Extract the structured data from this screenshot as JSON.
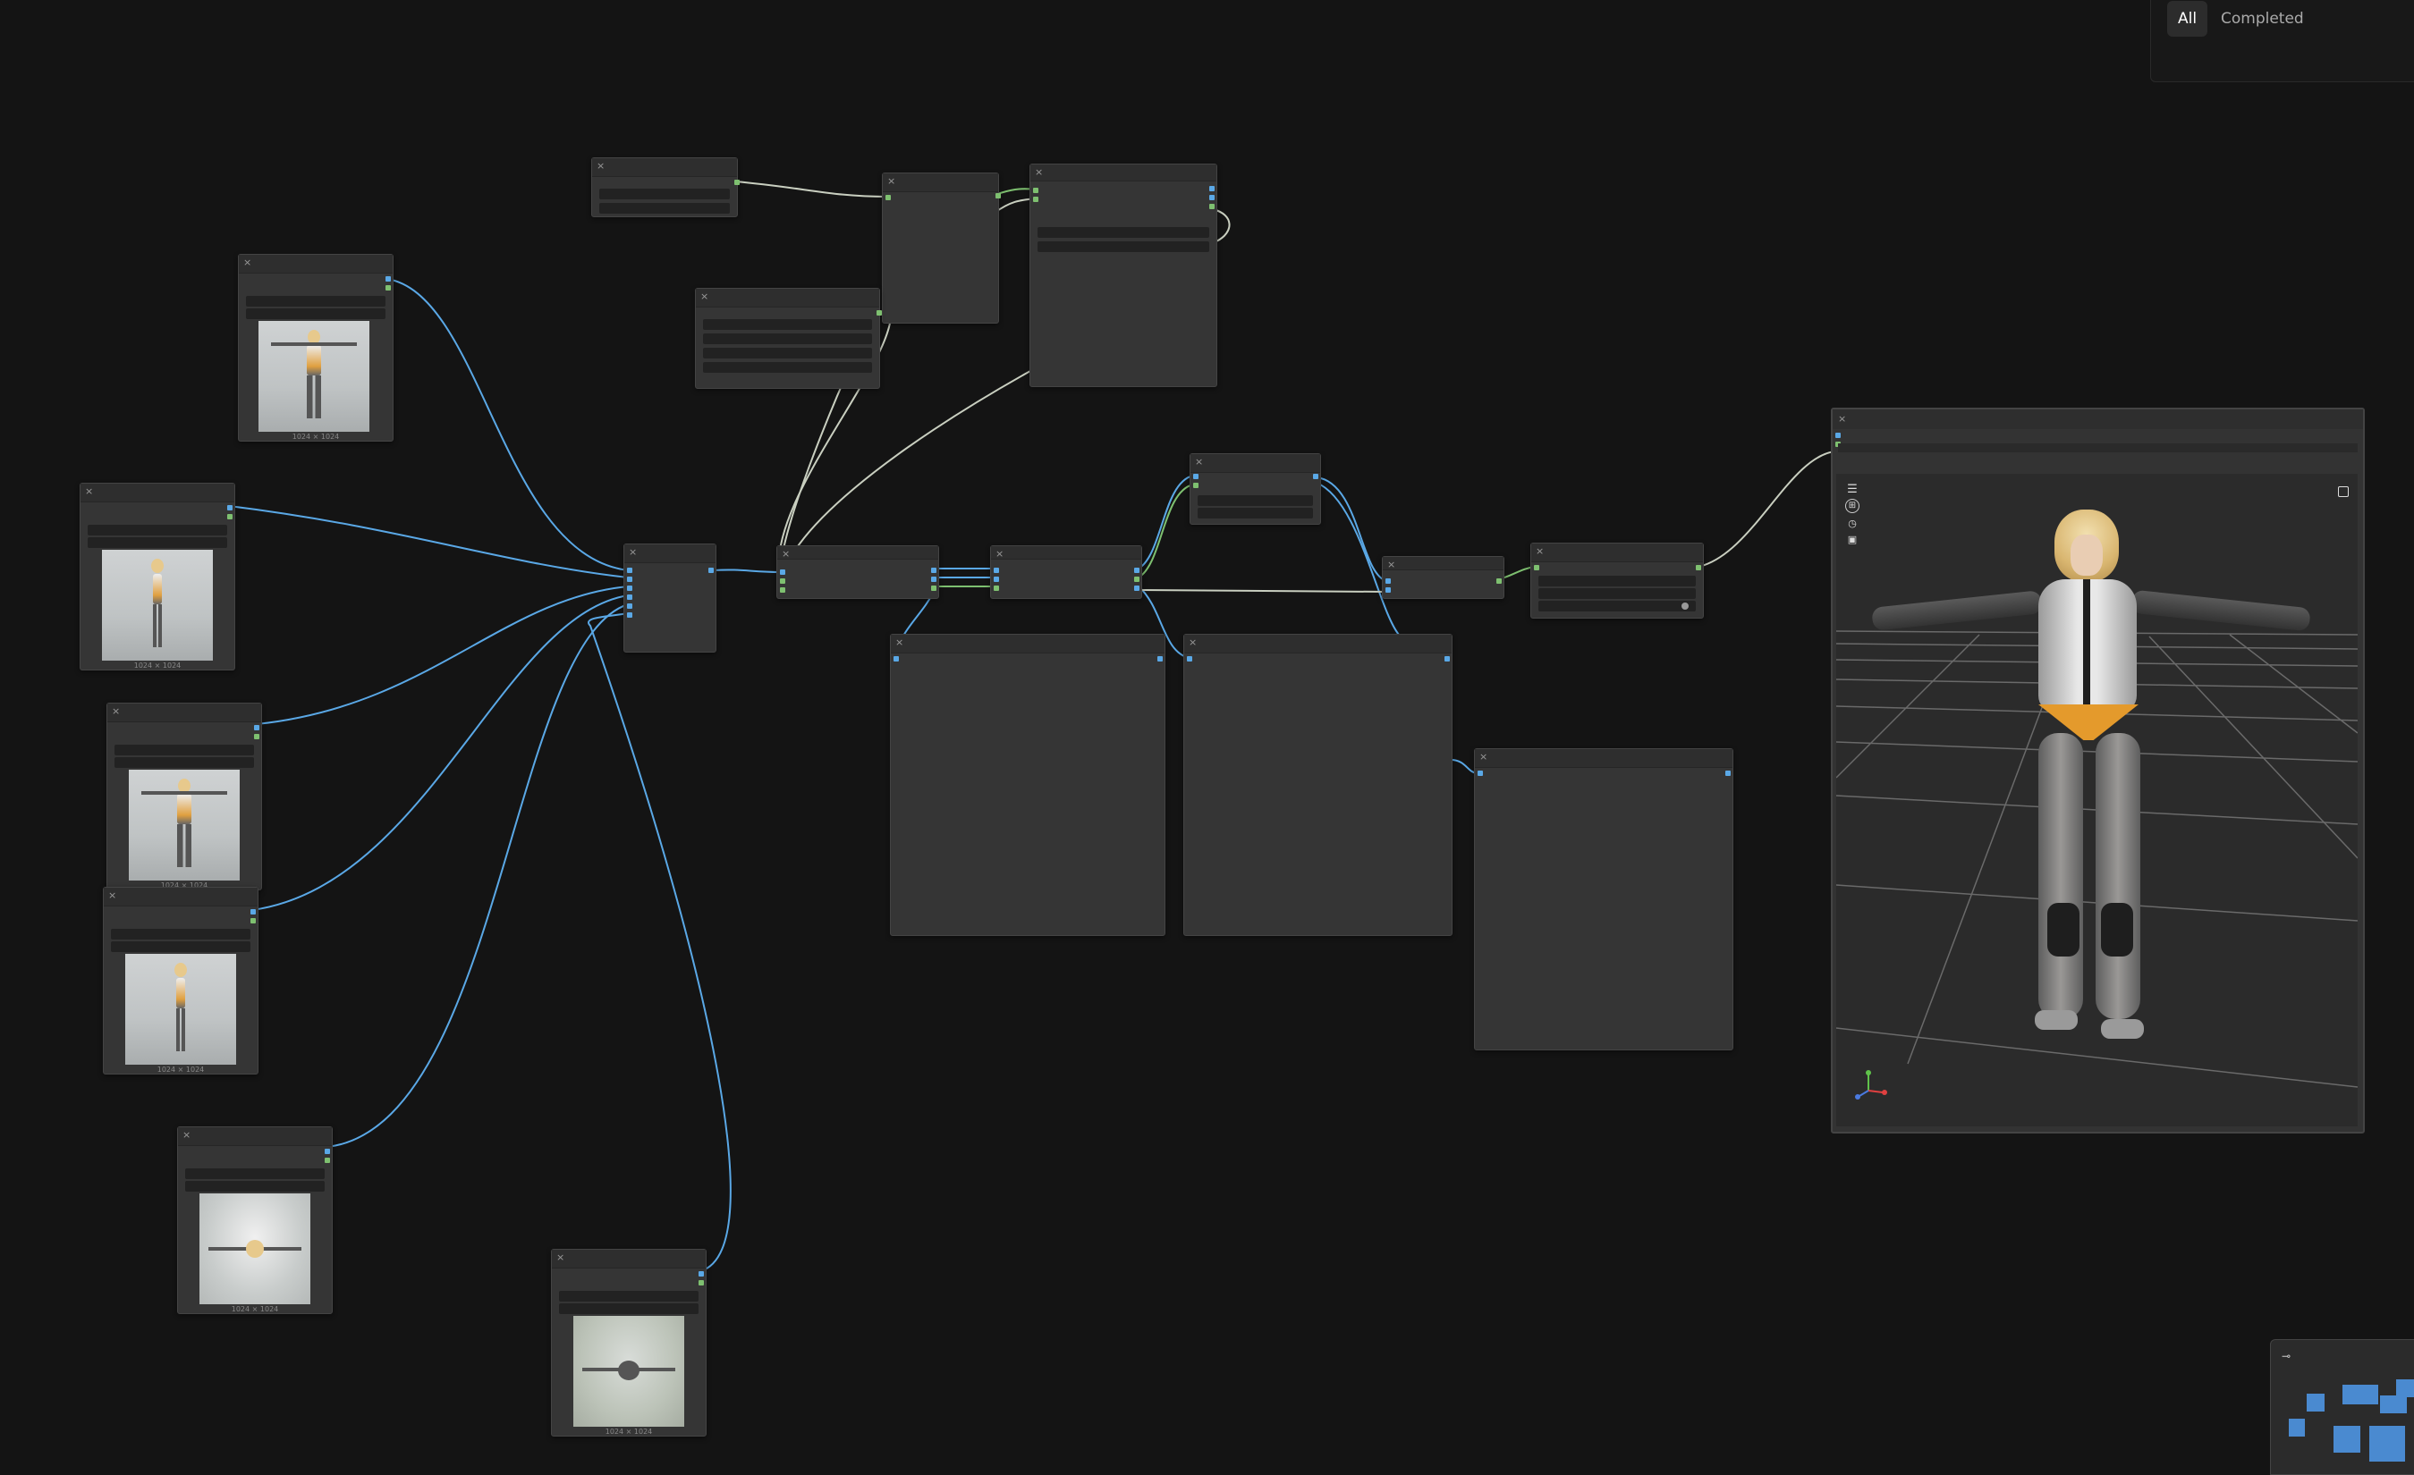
{
  "queue_panel": {
    "tabs": [
      {
        "label": "All",
        "active": true
      },
      {
        "label": "Completed",
        "active": false
      }
    ]
  },
  "nodes": {
    "close_glyph": "×",
    "image_captions": [
      "1024 × 1024",
      "1024 × 1024",
      "1024 × 1024",
      "1024 × 1024",
      "1024 × 1024",
      "1024 × 1024"
    ]
  },
  "viewer": {
    "tool_icons": [
      "menu-icon",
      "grid-icon",
      "camera-icon",
      "image-icon"
    ],
    "expand_icon": "expand-icon"
  },
  "colors": {
    "canvas_bg": "#141414",
    "node_bg": "#353535",
    "wire_image": "#5aa8e6",
    "wire_other": "#c9cfc0"
  }
}
